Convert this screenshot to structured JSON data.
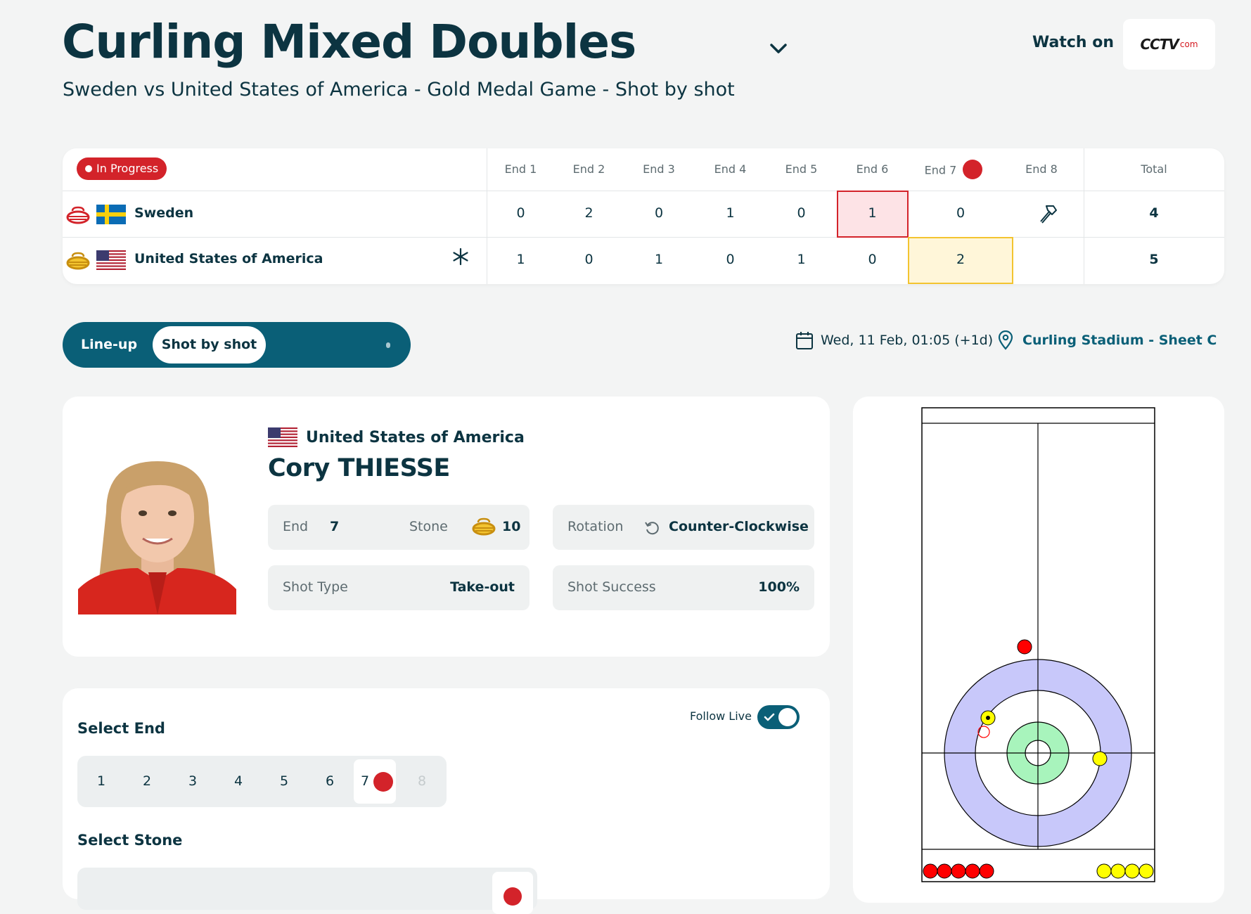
{
  "header": {
    "title": "Curling Mixed Doubles",
    "subtitle": "Sweden vs United States of America - Gold Medal Game - Shot by shot",
    "watch_label": "Watch on",
    "broadcaster_logo_text": "CCTV",
    "broadcaster_logo_sub": "com"
  },
  "scoreboard": {
    "status": "In Progress",
    "ends": [
      "End 1",
      "End 2",
      "End 3",
      "End 4",
      "End 5",
      "End 6",
      "End 7",
      "End 8"
    ],
    "total_label": "Total",
    "teams": [
      {
        "name": "Sweden",
        "stone_color": "red",
        "scores": [
          "0",
          "2",
          "0",
          "1",
          "0",
          "1",
          "0",
          ""
        ],
        "total": "4",
        "hammer_icon": "hammer-icon"
      },
      {
        "name": "United States of America",
        "stone_color": "yellow",
        "scores": [
          "1",
          "0",
          "1",
          "0",
          "1",
          "0",
          "2",
          ""
        ],
        "total": "5",
        "powerplay_icon": "asterisk-icon"
      }
    ],
    "colors": {
      "red": "#d3232a",
      "yellow": "#f3c430",
      "accent": "#0a5f77"
    }
  },
  "tabs": {
    "lineup": "Line-up",
    "shot_by_shot": "Shot by shot"
  },
  "meta": {
    "datetime": "Wed, 11 Feb, 01:05 (+1d)",
    "venue": "Curling Stadium - Sheet C"
  },
  "player": {
    "country": "United States of America",
    "name": "Cory THIESSE",
    "end_label": "End",
    "end_value": "7",
    "stone_label": "Stone",
    "stone_value": "10",
    "rotation_label": "Rotation",
    "rotation_value": "Counter-Clockwise",
    "shot_type_label": "Shot Type",
    "shot_type_value": "Take-out",
    "shot_success_label": "Shot Success",
    "shot_success_value": "100%"
  },
  "selector": {
    "follow_live_label": "Follow Live",
    "follow_live": true,
    "select_end_label": "Select End",
    "ends": [
      "1",
      "2",
      "3",
      "4",
      "5",
      "6",
      "7",
      "8"
    ],
    "selected_end": "7",
    "select_stone_label": "Select Stone"
  }
}
